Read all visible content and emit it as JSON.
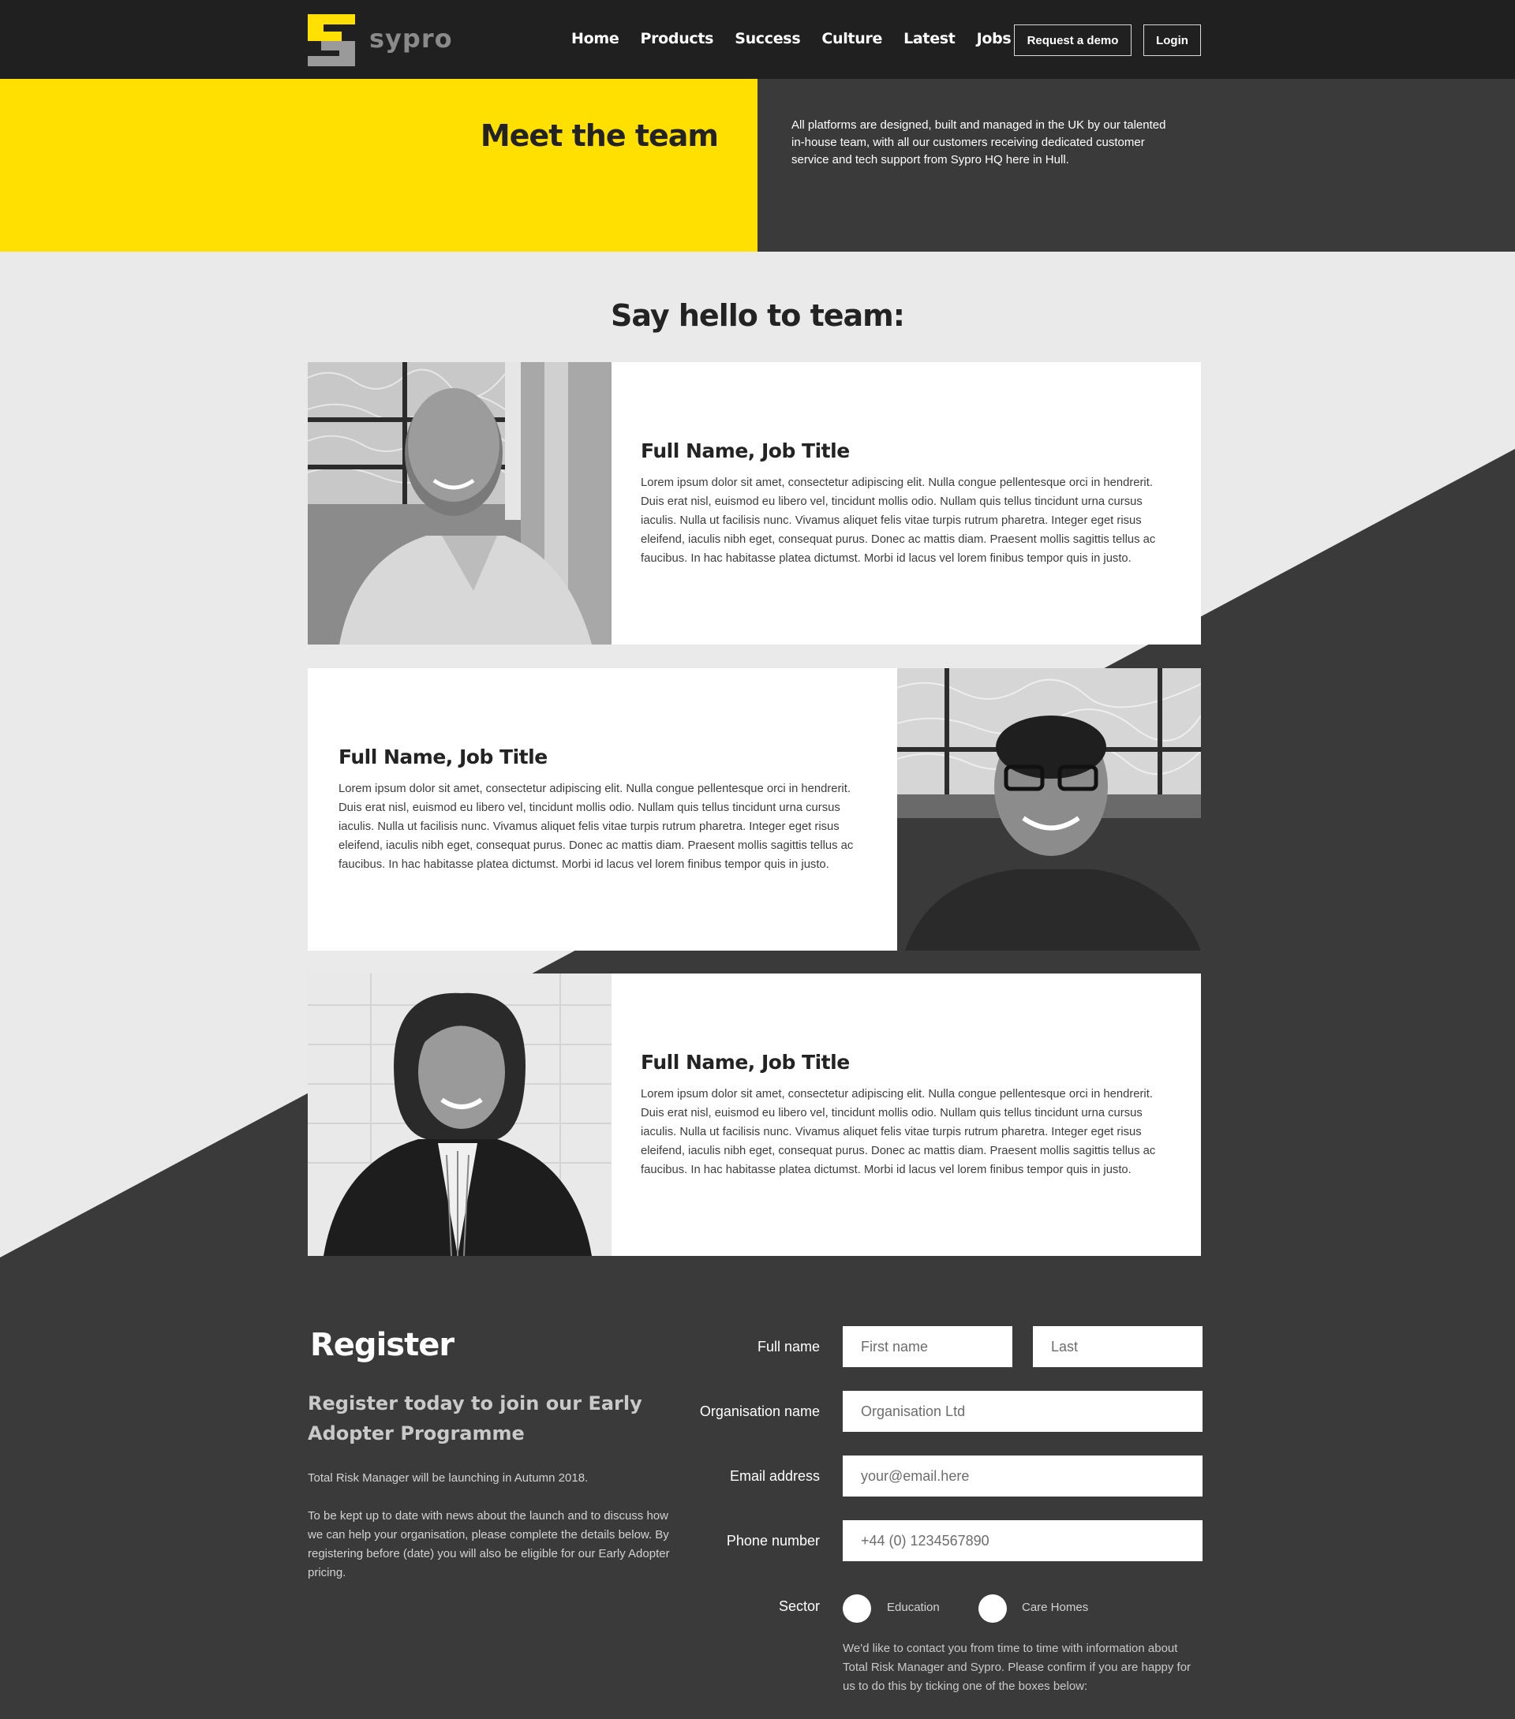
{
  "brand": {
    "logo_text": "sypro",
    "accent": "#ffe000",
    "dark": "#3a3a3b",
    "header_bg": "#202021"
  },
  "nav": {
    "items": [
      "Home",
      "Products",
      "Success",
      "Culture",
      "Latest",
      "Jobs"
    ],
    "demo_label": "Request a demo",
    "login_label": "Login"
  },
  "hero": {
    "title": "Meet the team",
    "description": "All platforms are designed, built and managed in the UK by our talented in-house team, with all our customers receiving dedicated customer service and tech support from Sypro HQ here in Hull."
  },
  "team": {
    "heading": "Say hello to team:",
    "members": [
      {
        "name": "Full Name, Job Title",
        "bio": "Lorem ipsum dolor sit amet, consectetur adipiscing elit. Nulla congue pellentesque orci in hendrerit. Duis erat nisl, euismod eu libero vel, tincidunt mollis odio. Nullam quis tellus tincidunt urna cursus iaculis. Nulla ut facilisis nunc. Vivamus aliquet felis vitae turpis rutrum pharetra. Integer eget risus eleifend, iaculis nibh eget, consequat purus. Donec ac mattis diam. Praesent mollis sagittis tellus ac faucibus. In hac habitasse platea dictumst. Morbi id lacus vel lorem finibus tempor quis in justo."
      },
      {
        "name": "Full Name, Job Title",
        "bio": "Lorem ipsum dolor sit amet, consectetur adipiscing elit. Nulla congue pellentesque orci in hendrerit. Duis erat nisl, euismod eu libero vel, tincidunt mollis odio. Nullam quis tellus tincidunt urna cursus iaculis. Nulla ut facilisis nunc. Vivamus aliquet felis vitae turpis rutrum pharetra. Integer eget risus eleifend, iaculis nibh eget, consequat purus. Donec ac mattis diam. Praesent mollis sagittis tellus ac faucibus. In hac habitasse platea dictumst. Morbi id lacus vel lorem finibus tempor quis in justo."
      },
      {
        "name": "Full Name, Job Title",
        "bio": "Lorem ipsum dolor sit amet, consectetur adipiscing elit. Nulla congue pellentesque orci in hendrerit. Duis erat nisl, euismod eu libero vel, tincidunt mollis odio. Nullam quis tellus tincidunt urna cursus iaculis. Nulla ut facilisis nunc. Vivamus aliquet felis vitae turpis rutrum pharetra. Integer eget risus eleifend, iaculis nibh eget, consequat purus. Donec ac mattis diam. Praesent mollis sagittis tellus ac faucibus. In hac habitasse platea dictumst. Morbi id lacus vel lorem finibus tempor quis in justo."
      }
    ]
  },
  "register": {
    "title": "Register",
    "subtitle": "Register today to join our Early Adopter Programme",
    "para1": "Total Risk Manager will be launching in Autumn 2018.",
    "para2": "To be kept up to date with news about the launch and to discuss how we can help your organisation, please complete the details below.  By registering before (date) you will also be eligible for our Early Adopter pricing.",
    "form": {
      "full_name_label": "Full name",
      "first_placeholder": "First name",
      "last_placeholder": "Last",
      "org_label": "Organisation name",
      "org_placeholder": "Organisation Ltd",
      "email_label": "Email address",
      "email_placeholder": "your@email.here",
      "phone_label": "Phone number",
      "phone_placeholder": "+44 (0) 1234567890",
      "sector_label": "Sector",
      "sector_options": [
        "Education",
        "Care Homes"
      ],
      "consent": "We'd like to contact you from time to time with information about Total Risk Manager and Sypro.  Please confirm if you are happy for us to do this by ticking one of the boxes below:"
    }
  }
}
